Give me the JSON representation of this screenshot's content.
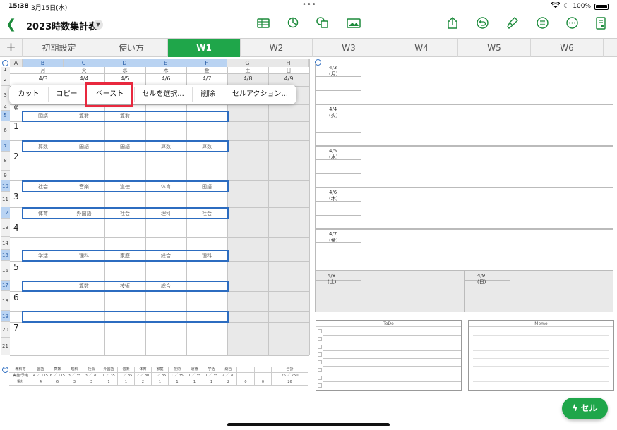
{
  "status": {
    "time": "15:38",
    "date": "3月15日(水)",
    "battery": "100%"
  },
  "doc": {
    "title": "2023時数集計表"
  },
  "toolbar_icons": [
    "table-icon",
    "chart-icon",
    "shapes-icon",
    "media-icon",
    "share-icon",
    "undo-icon",
    "format-brush-icon",
    "menu-icon",
    "more-icon",
    "document-icon"
  ],
  "tabs": {
    "items": [
      "初期設定",
      "使い方",
      "W1",
      "W2",
      "W3",
      "W4",
      "W5",
      "W6"
    ],
    "active": "W1"
  },
  "sheet": {
    "col_letters": [
      "A",
      "B",
      "C",
      "D",
      "E",
      "F",
      "G",
      "H"
    ],
    "weekdays": [
      "月",
      "火",
      "水",
      "木",
      "金",
      "土",
      "日"
    ],
    "dates": [
      "4/3",
      "4/4",
      "4/5",
      "4/6",
      "4/7",
      "4/8",
      "4/9"
    ],
    "row_numbers": [
      "1",
      "2",
      "3",
      "4",
      "5",
      "6",
      "7",
      "8",
      "9",
      "10",
      "11",
      "12",
      "13",
      "14",
      "15",
      "16",
      "17",
      "18",
      "19",
      "20",
      "21"
    ],
    "asa": "朝",
    "periods": [
      "1",
      "2",
      "3",
      "4",
      "5",
      "6",
      "7"
    ],
    "subjects": [
      [
        "国語",
        "算数",
        "算数",
        "",
        ""
      ],
      [
        "算数",
        "国語",
        "国語",
        "算数",
        "算数"
      ],
      [
        "社会",
        "音楽",
        "道徳",
        "体育",
        "国語"
      ],
      [
        "体育",
        "外国語",
        "社会",
        "理科",
        "社会"
      ],
      [
        "学活",
        "理科",
        "家庭",
        "総合",
        "理科"
      ],
      [
        "",
        "算数",
        "技術",
        "総合",
        ""
      ],
      [
        "",
        "",
        "",
        "",
        ""
      ]
    ]
  },
  "popup": {
    "items": [
      "カット",
      "コピー",
      "ペースト",
      "セルを選択...",
      "削除",
      "セルアクション..."
    ],
    "highlighted": "ペースト"
  },
  "summary": {
    "header": [
      "教科等",
      "国語",
      "算数",
      "理科",
      "社会",
      "外国語",
      "音楽",
      "体育",
      "家庭",
      "技術",
      "道徳",
      "学活",
      "総合",
      "",
      "",
      "合計"
    ],
    "row2": [
      "実施/予定",
      "4 ／ 175",
      "6 ／ 175",
      "3 ／ 35",
      "3 ／ 70",
      "1 ／ 35",
      "1 ／ 35",
      "2 ／ 80",
      "1 ／ 35",
      "1 ／ 35",
      "1 ／ 35",
      "1 ／ 35",
      "2 ／ 70",
      "",
      "",
      "26 ／ 750"
    ],
    "row3": [
      "累計",
      "4",
      "6",
      "3",
      "3",
      "1",
      "1",
      "2",
      "1",
      "1",
      "1",
      "1",
      "2",
      "0",
      "0",
      "26"
    ]
  },
  "calendar": {
    "days": [
      "4/3 (月)",
      "4/4 (火)",
      "4/5 (水)",
      "4/6 (木)",
      "4/7 (金)"
    ],
    "weekend": [
      "4/8 (土)",
      "4/9 (日)"
    ]
  },
  "todos": {
    "title": "ToDo"
  },
  "memo": {
    "title": "Memo"
  },
  "fab": {
    "label": "セル"
  },
  "colors": {
    "accent": "#1fa64a",
    "selection": "#2c6cc0",
    "highlight": "#e8283e"
  }
}
